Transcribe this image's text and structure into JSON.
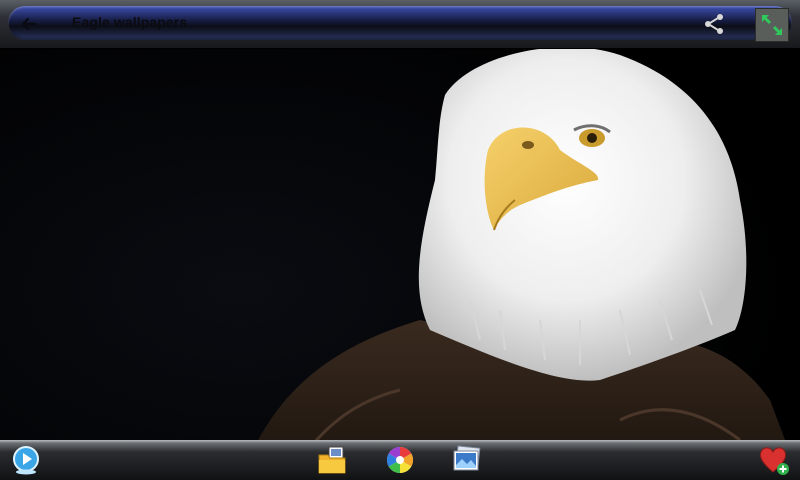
{
  "app": {
    "title": "Eagle wallpapers"
  },
  "toolbar": {
    "back_icon": "arrow-left-icon",
    "share_icon": "share-icon",
    "fullscreen_icon": "expand-arrows-icon"
  },
  "bottom_toolbar": {
    "items": [
      {
        "icon": "play-slideshow-icon"
      },
      {
        "icon": "folder-images-icon"
      },
      {
        "icon": "color-wheel-icon"
      },
      {
        "icon": "set-wallpaper-icon"
      },
      {
        "icon": "favorite-add-icon"
      }
    ]
  },
  "colors": {
    "accent_blue": "#3e4fb3",
    "fullscreen_green": "#2ec95a",
    "favorite_red": "#d8312f"
  }
}
